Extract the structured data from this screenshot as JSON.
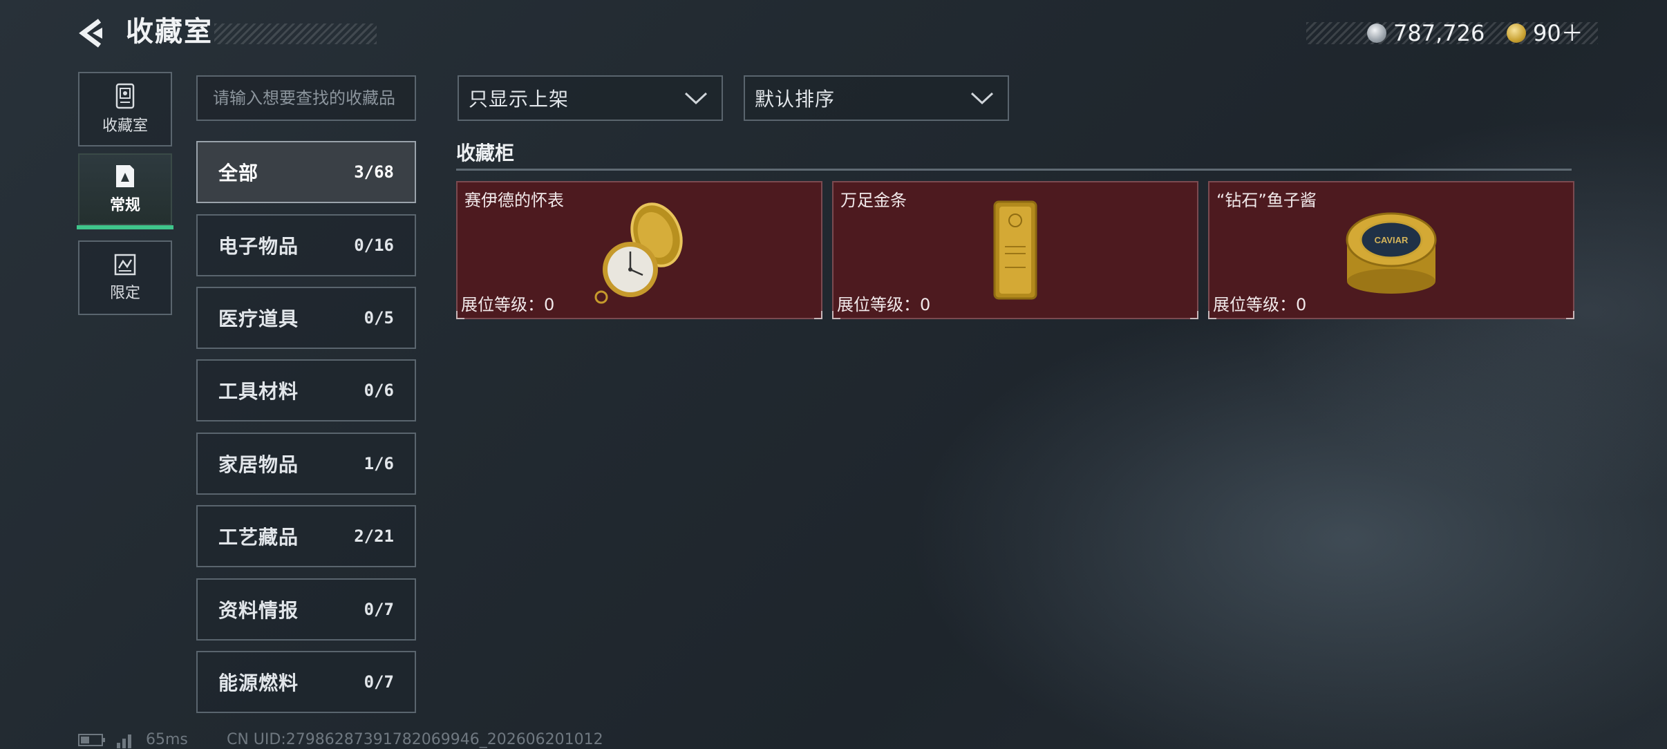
{
  "header": {
    "title": "收藏室",
    "currency_silver": "787,726",
    "currency_gold": "90＋"
  },
  "side_tabs": [
    {
      "label": "收藏室",
      "icon": "collection-room-icon"
    },
    {
      "label": "常规",
      "icon": "regular-icon",
      "active": true
    },
    {
      "label": "限定",
      "icon": "limited-icon"
    }
  ],
  "search": {
    "placeholder": "请输入想要查找的收藏品"
  },
  "categories": [
    {
      "name": "全部",
      "count": "3/68",
      "active": true
    },
    {
      "name": "电子物品",
      "count": "0/16"
    },
    {
      "name": "医疗道具",
      "count": "0/5"
    },
    {
      "name": "工具材料",
      "count": "0/6"
    },
    {
      "name": "家居物品",
      "count": "1/6"
    },
    {
      "name": "工艺藏品",
      "count": "2/21"
    },
    {
      "name": "资料情报",
      "count": "0/7"
    },
    {
      "name": "能源燃料",
      "count": "0/7"
    }
  ],
  "filters": {
    "display": "只显示上架",
    "sort": "默认排序"
  },
  "cabinet": {
    "title": "收藏柜",
    "items": [
      {
        "name": "赛伊德的怀表",
        "level": "展位等级：0",
        "icon": "pocket-watch-icon"
      },
      {
        "name": "万足金条",
        "level": "展位等级：0",
        "icon": "gold-bar-icon"
      },
      {
        "name": "“钻石”鱼子酱",
        "level": "展位等级：0",
        "icon": "caviar-tin-icon",
        "tin_text": "CAVIAR"
      }
    ]
  },
  "status": {
    "ping": "65ms",
    "uid": "CN UID:27986287391782069946_202606201012"
  },
  "colors": {
    "accent_green": "#3fc58b",
    "card_bg": "#4d1a1f",
    "gold": "#c9a233"
  }
}
